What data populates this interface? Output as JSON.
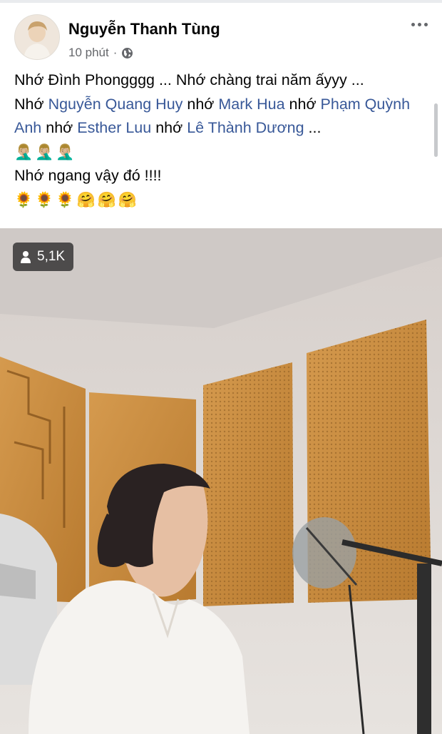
{
  "post": {
    "author_name": "Nguyễn Thanh Tùng",
    "time": "10 phút",
    "separator": "·",
    "privacy_icon": "globe-icon",
    "more_icon": "more-options-icon",
    "lines": {
      "l1": "Nhớ Đình Phongggg ... Nhớ chàng trai năm ấyyy ...",
      "l2_prefix": "Nhớ ",
      "mention_1": "Nguyễn Quang Huy",
      "l2_mid1": " nhớ ",
      "mention_2": "Mark Hua",
      "l2_mid2": " nhớ ",
      "mention_3": "Phạm Quỳnh Anh",
      "l3_mid1": " nhớ ",
      "mention_4": "Esther Luu",
      "l3_mid2": " nhớ ",
      "mention_5": "Lê Thành Dương",
      "l3_suffix": " ...",
      "emoji_line_1": "🤦🏼‍♂️🤦🏼‍♂️🤦🏼‍♂️",
      "l4": "Nhớ ngang vậy đó !!!!",
      "emoji_line_2": "🌻🌻🌻🤗🤗🤗"
    }
  },
  "video": {
    "viewer_count": "5,1K",
    "viewer_icon": "person-icon"
  },
  "colors": {
    "mention": "#385898",
    "meta_text": "#65676b",
    "badge_bg": "#282828"
  }
}
